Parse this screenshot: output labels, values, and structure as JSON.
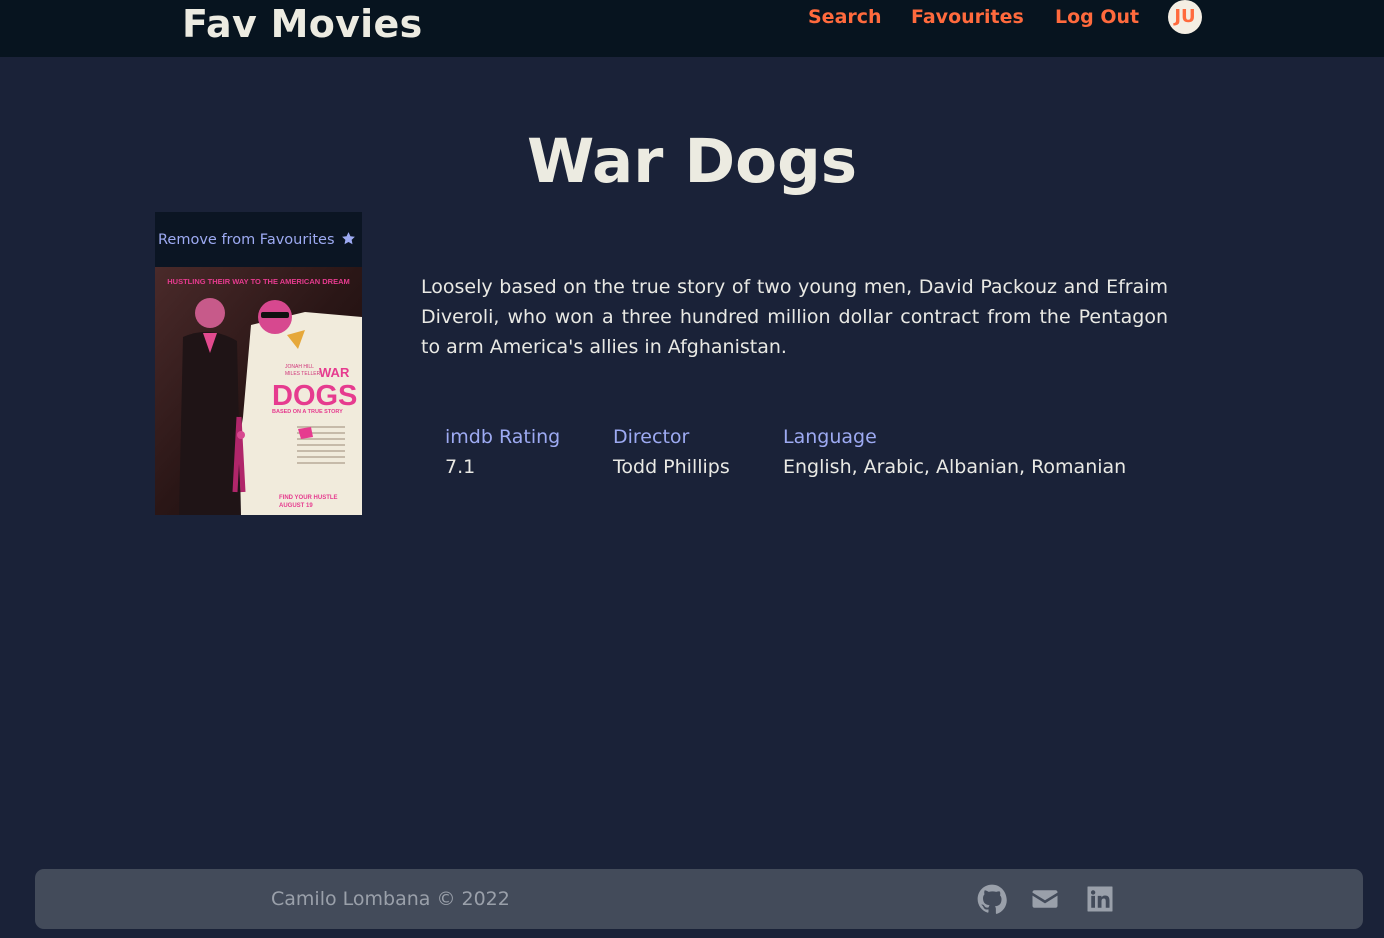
{
  "nav": {
    "brand": "Fav Movies",
    "links": [
      "Search",
      "Favourites",
      "Log Out"
    ],
    "avatar_initials": "JU"
  },
  "movie": {
    "title": "War Dogs",
    "favourite_button": "Remove from Favourites",
    "favourite_icon": "star-icon",
    "poster": {
      "top_tagline": "HUSTLING THEIR WAY TO THE AMERICAN DREAM",
      "cast_1": "JONAH HILL",
      "cast_2": "MILES TELLER",
      "title_line_1": "WAR",
      "title_line_2": "DOGS",
      "subtitle": "BASED ON A TRUE STORY",
      "bottom_line_1": "FIND YOUR HUSTLE",
      "bottom_line_2": "AUGUST 19"
    },
    "plot": "Loosely based on the true story of two young men, David Packouz and Efraim Diveroli, who won a three hundred million dollar contract from the Pentagon to arm America's allies in Afghanistan.",
    "info": {
      "rating_label": "imdb Rating",
      "rating_value": "7.1",
      "director_label": "Director",
      "director_value": "Todd Phillips",
      "language_label": "Language",
      "language_value": "English, Arabic, Albanian, Romanian"
    }
  },
  "footer": {
    "copyright": "Camilo Lombana © 2022",
    "icons": [
      "github-icon",
      "mail-icon",
      "linkedin-icon"
    ]
  },
  "colors": {
    "background": "#1a2238",
    "navbar": "#07141f",
    "accent": "#ff6a3d",
    "label": "#9daaf2",
    "footer": "#434b5a"
  }
}
